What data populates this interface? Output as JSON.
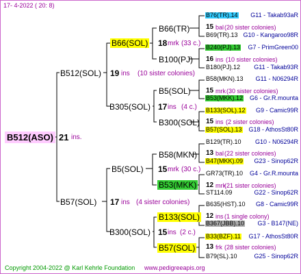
{
  "header": {
    "date": "17-  4-2022 ( 20:  8)"
  },
  "root": {
    "label": "B512(ASO)",
    "count": "21",
    "unit": "ins."
  },
  "gen1": [
    {
      "label": "B512(SOL)",
      "count": "19",
      "unit": "ins",
      "note": "(10 sister colonies)"
    },
    {
      "label": "B57(SOL)",
      "count": "17",
      "unit": "ins",
      "note": "(4 sister colonies)"
    }
  ],
  "gen2": [
    {
      "label": "B66(SOL)",
      "count": "18",
      "unit": "mrk",
      "note": "(33 c.)"
    },
    {
      "label": "B305(SOL)",
      "count": "17",
      "unit": "ins",
      "note": "(4 c.)"
    },
    {
      "label": "B5(SOL)",
      "count": "15",
      "unit": "mrk",
      "note": "(30 c.)"
    },
    {
      "label": "B300(SOL)",
      "count": "15",
      "unit": "ins",
      "note": "(2 c.)"
    }
  ],
  "gen3": [
    {
      "label": "B66(TR)",
      "count": "15",
      "unit": "bal",
      "note": "(20 sister colonies)"
    },
    {
      "label": "B100(PJ)",
      "count": "16",
      "unit": "ins",
      "note": "(10 sister colonies)"
    },
    {
      "label": "B5(SOL)",
      "count": "15",
      "unit": "mrk",
      "note": "(30 sister colonies)"
    },
    {
      "label": "B300(SOL)",
      "count": "15",
      "unit": "ins",
      "note": "(2 sister colonies)"
    },
    {
      "label": "B58(MKN)",
      "count": "13",
      "unit": "bal",
      "note": "(22 sister colonies)"
    },
    {
      "label": "B53(MKK)",
      "count": "12",
      "unit": "mrk",
      "note": "(21 sister colonies)"
    },
    {
      "label": "B133(SOL)",
      "count": "12",
      "unit": "ins",
      "note": "(1 single colony)"
    },
    {
      "label": "B57(SOL)",
      "count": "13",
      "unit": "frk",
      "note": "(28 sister colonies)"
    }
  ],
  "gen4": [
    {
      "left": "B76(TR).14",
      "right": "G11 - Takab93aR"
    },
    {
      "left": "B69(TR).13",
      "right": "G10 - Kangaroo98R"
    },
    {
      "left": "B240(PJ).13",
      "right": "G7 - PrimGreen00"
    },
    {
      "left": "B180(PJ).12",
      "right": "G11 - Takab93R"
    },
    {
      "left": "B58(MKN).13",
      "right": "G11 - N06294R"
    },
    {
      "left": "B53(MKK).12",
      "right": "G6 - Gr.R.mounta"
    },
    {
      "left": "B133(SOL).12",
      "right": "G9 - Camic99R"
    },
    {
      "left": "B57(SOL).13",
      "right": "G18 - AthosSt80R"
    },
    {
      "left": "B129(TR).10",
      "right": "G10 - N06294R"
    },
    {
      "left": "B47(MKK).09",
      "right": "G23 - Sinop62R"
    },
    {
      "left": "GR73(TR).10",
      "right": "G4 - Gr.R.mounta"
    },
    {
      "left": "ST114.09",
      "right": "G22 - Sinop62R"
    },
    {
      "left": "B635(HST).10",
      "right": "G8 - Camic99R"
    },
    {
      "left": "B367(JBB).10",
      "right": "G3 - B147(NE)"
    },
    {
      "left": "B33(BZF).11",
      "right": "G17 - AthosSt80R"
    },
    {
      "left": "B79(SL).10",
      "right": "G25 - Sinop62R"
    }
  ],
  "footer": {
    "copyright": "Copyright 2004-2022 @ Karl Kehrle Foundation",
    "url": "www.pedigreeapis.org"
  },
  "colors": {
    "frame": "#cc66cc",
    "accent": "#990099",
    "yellow": "#ffff00",
    "green": "#33cc33",
    "cyan": "#33ccff"
  }
}
